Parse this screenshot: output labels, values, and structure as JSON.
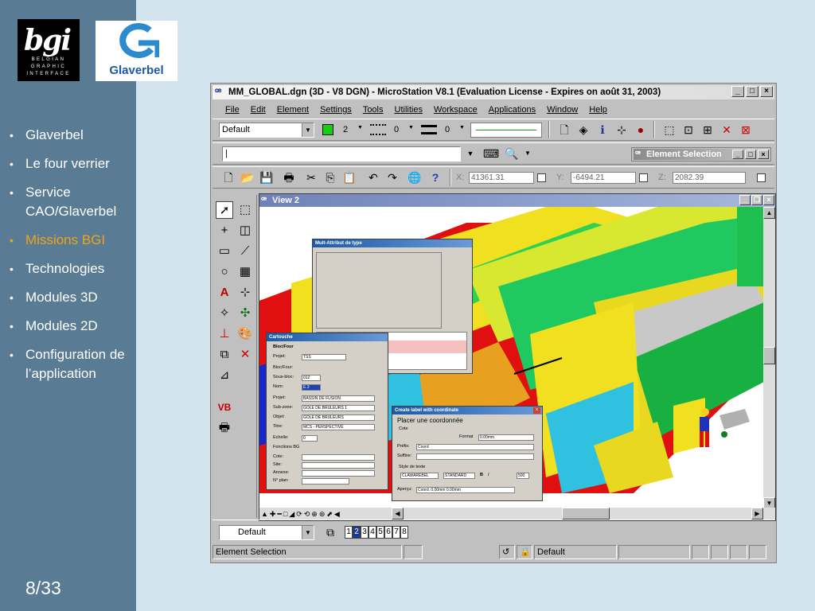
{
  "slide": {
    "logo_bgi": {
      "mark": "bgi",
      "line1": "BELGIAN",
      "line2": "GRAPHIC",
      "line3": "INTERFACE"
    },
    "logo_glaverbel": {
      "text": "Glaverbel"
    },
    "bullets": [
      {
        "label": "Glaverbel",
        "active": false
      },
      {
        "label": "Le four verrier",
        "active": false
      },
      {
        "label": "Service CAO/Glaverbel",
        "active": false
      },
      {
        "label": "Missions BGI",
        "active": true
      },
      {
        "label": "Technologies",
        "active": false
      },
      {
        "label": "Modules 3D",
        "active": false
      },
      {
        "label": "Modules 2D",
        "active": false
      },
      {
        "label": "Configuration de l’application",
        "active": false
      }
    ],
    "page_number": "8/33",
    "accent_color": "#f0a31d",
    "sidebar_color": "#597b93"
  },
  "window": {
    "title": "MM_GLOBAL.dgn (3D - V8 DGN) - MicroStation V8.1 (Evaluation License - Expires on août 31, 2003)",
    "menu": [
      "File",
      "Edit",
      "Element",
      "Settings",
      "Tools",
      "Utilities",
      "Workspace",
      "Applications",
      "Window",
      "Help"
    ],
    "attributes": {
      "level": "Default",
      "color_index": "2",
      "style_index": "0",
      "weight_index": "0"
    },
    "keyin_value": "|",
    "coordinates": {
      "x_label": "X:",
      "x": "41361.31",
      "y_label": "Y:",
      "y": "-6494.21",
      "z_label": "Z:",
      "z": "2082.39"
    },
    "element_selection": {
      "title": "Element Selection"
    },
    "view": {
      "title": "View 2"
    },
    "view_group": {
      "value": "Default"
    },
    "view_buttons": [
      "1",
      "2",
      "3",
      "4",
      "5",
      "6",
      "7",
      "8"
    ],
    "selected_view": "2",
    "status": {
      "message": "Element Selection",
      "level": "Default"
    }
  },
  "dialogs": {
    "settings_dialog": {
      "title": "Mult-Attribut de type"
    },
    "cartouche": {
      "title": "Cartouche",
      "heading": "Bloc/Four",
      "rows": [
        {
          "label": "Projet:",
          "value": "TSS"
        },
        {
          "label": "Bloc/Four:",
          "value": ""
        },
        {
          "label": "Sous-bloc:",
          "value": "012"
        },
        {
          "label": "Nom:",
          "value": "E.3"
        },
        {
          "label": "Projet:",
          "value": "BASSIN DE FUSION"
        },
        {
          "label": "Sub-zone:",
          "value": "GÔLE DE BRÛLEURS 1"
        },
        {
          "label": "Objet:",
          "value": "GÔLE DE BRÛLEURS"
        },
        {
          "label": "Titre:",
          "value": "MCS - PERSPECTIVE"
        },
        {
          "label": "Echelle:",
          "value": "0"
        }
      ],
      "section": "Fonctions BG",
      "extra_rows": [
        "Cote:",
        "Site:",
        "Annexe:",
        "N° plan:"
      ]
    },
    "label_dialog": {
      "title": "Create label with coordinate",
      "heading": "Placer une coordonnée",
      "section": "Cote",
      "format_label": "Format",
      "format_value": "0.00mm",
      "prefix_label": "Préfix:",
      "prefix_value": "Coord",
      "suffix_label": "Suffixe:",
      "style_section": "Style de texte",
      "font_value": "CLAWAREBEL",
      "style_value": "STANDARD",
      "size_value": "500",
      "apercu_label": "Aperçu:",
      "apercu_value": "Coord. 0.00mm 0.00mm"
    }
  }
}
